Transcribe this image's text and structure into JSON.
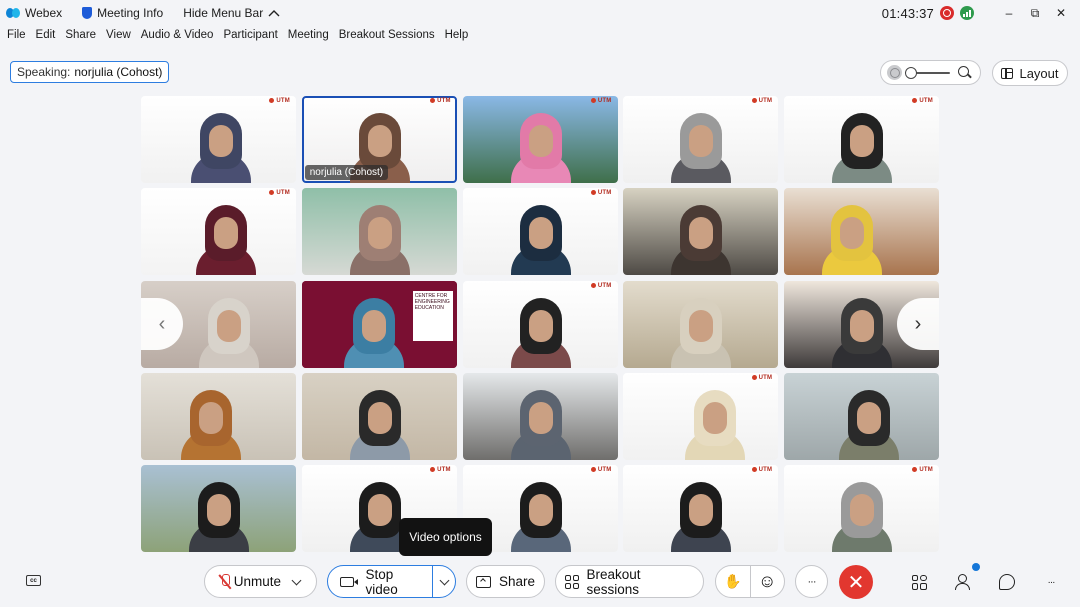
{
  "titlebar": {
    "app_name": "Webex",
    "meeting_info": "Meeting Info",
    "hide_menu_bar": "Hide Menu Bar",
    "time": "01:43:37",
    "minimize": "–",
    "restore": "⧉",
    "close": "✕"
  },
  "menu": [
    "File",
    "Edit",
    "Share",
    "View",
    "Audio & Video",
    "Participant",
    "Meeting",
    "Breakout Sessions",
    "Help"
  ],
  "speaking": {
    "label": "Speaking:",
    "name": "norjulia (Cohost)"
  },
  "layout_button": {
    "label": "Layout"
  },
  "zoom_level": 0,
  "tiles": [
    {
      "name": "",
      "brand": true,
      "bg": [
        "#ffffff",
        "#f1f1f1"
      ],
      "hair": "#3f4663",
      "shirt": "#4a4f72",
      "pos": 50
    },
    {
      "name": "norjulia (Cohost)",
      "brand": true,
      "active": true,
      "bg": [
        "#ffffff",
        "#efeeee"
      ],
      "hair": "#6a4a3a",
      "shirt": "#8a5f4b",
      "pos": 48
    },
    {
      "name": "",
      "brand": true,
      "bg": [
        "#8ab8e6",
        "#3f6f4a"
      ],
      "hair": "#e27aa8",
      "shirt": "#e888b6",
      "pos": 48
    },
    {
      "name": "",
      "brand": true,
      "bg": [
        "#ffffff",
        "#f0f0f0"
      ],
      "hair": "#9a9a9a",
      "shirt": "#5a5a60",
      "pos": 48
    },
    {
      "name": "",
      "brand": true,
      "bg": [
        "#ffffff",
        "#f0f0f0"
      ],
      "hair": "#222222",
      "shirt": "#7c8b84",
      "pos": 48
    },
    {
      "name": "",
      "brand": true,
      "bg": [
        "#ffffff",
        "#f3f3f3"
      ],
      "hair": "#5a1c2a",
      "shirt": "#6a1e2e",
      "pos": 55
    },
    {
      "name": "",
      "brand": false,
      "bg": [
        "#8fbfa8",
        "#d6d9d4"
      ],
      "hair": "#9e7f74",
      "shirt": "#8a7068",
      "pos": 48
    },
    {
      "name": "",
      "brand": true,
      "bg": [
        "#ffffff",
        "#f1f1f1"
      ],
      "hair": "#1c2d40",
      "shirt": "#223a52",
      "pos": 48
    },
    {
      "name": "",
      "brand": false,
      "bg": [
        "#d7d2c2",
        "#4e4a45"
      ],
      "hair": "#4b3b35",
      "shirt": "#3d3530",
      "pos": 48
    },
    {
      "name": "",
      "brand": false,
      "bg": [
        "#e9dfd3",
        "#a8744e"
      ],
      "hair": "#e3c33f",
      "shirt": "#ebc93e",
      "pos": 38
    },
    {
      "name": "",
      "brand": false,
      "bg": [
        "#d7cfc8",
        "#b8aba3"
      ],
      "hair": "#d8d3cb",
      "shirt": "#cfc7bf",
      "pos": 58
    },
    {
      "name": "",
      "brand": false,
      "banner": true,
      "bg": [
        "#7a0f32",
        "#7a0f32"
      ],
      "hair": "#3c7ea3",
      "shirt": "#4f8fb3",
      "pos": 42
    },
    {
      "name": "",
      "brand": true,
      "bg": [
        "#ffffff",
        "#f1f1f1"
      ],
      "hair": "#222222",
      "shirt": "#7b4a4a",
      "pos": 48
    },
    {
      "name": "",
      "brand": false,
      "bg": [
        "#e3dccd",
        "#b5a990"
      ],
      "hair": "#d8d0bf",
      "shirt": "#c9c2b2",
      "pos": 48
    },
    {
      "name": "",
      "brand": false,
      "bg": [
        "#efe7dd",
        "#3e3a3a"
      ],
      "hair": "#3a3a3a",
      "shirt": "#2f2f33",
      "pos": 48
    },
    {
      "name": "",
      "brand": false,
      "bg": [
        "#e4e0d8",
        "#c9c2b6"
      ],
      "hair": "#a8652e",
      "shirt": "#b57332",
      "pos": 40
    },
    {
      "name": "",
      "brand": false,
      "bg": [
        "#d8d1c4",
        "#c3b7a5"
      ],
      "hair": "#2a2a2a",
      "shirt": "#8d9aa8",
      "pos": 48
    },
    {
      "name": "",
      "brand": false,
      "bg": [
        "#e5e8ea",
        "#6f6e6c"
      ],
      "hair": "#5c6470",
      "shirt": "#5b6470",
      "pos": 48
    },
    {
      "name": "",
      "brand": true,
      "bg": [
        "#ffffff",
        "#f1f1f1"
      ],
      "hair": "#e7dcc1",
      "shirt": "#e3d7b6",
      "pos": 62
    },
    {
      "name": "",
      "brand": false,
      "bg": [
        "#c8d2d5",
        "#9ea7a9"
      ],
      "hair": "#2a2a2a",
      "shirt": "#7b7e6a",
      "pos": 55
    },
    {
      "name": "",
      "brand": false,
      "bg": [
        "#a9c0d3",
        "#8da278"
      ],
      "hair": "#1c1c1c",
      "shirt": "#3b3e45",
      "pos": 48
    },
    {
      "name": "",
      "brand": true,
      "bg": [
        "#ffffff",
        "#f0f0f0"
      ],
      "hair": "#1c1c1c",
      "shirt": "#3f4a5a",
      "pos": 48
    },
    {
      "name": "",
      "brand": true,
      "bg": [
        "#ffffff",
        "#f0f0f0"
      ],
      "hair": "#1c1c1c",
      "shirt": "#59677a",
      "pos": 48
    },
    {
      "name": "",
      "brand": true,
      "bg": [
        "#ffffff",
        "#f0f0f0"
      ],
      "hair": "#1c1c1c",
      "shirt": "#3e4450",
      "pos": 48
    },
    {
      "name": "",
      "brand": true,
      "bg": [
        "#ffffff",
        "#f0f0f0"
      ],
      "hair": "#9a9a9a",
      "shirt": "#6e7a6c",
      "pos": 48
    }
  ],
  "banner_text": "CENTRE FOR ENGINEERING EDUCATION",
  "brand_text": "UTM",
  "nav": {
    "prev": "‹",
    "next": "›"
  },
  "tooltip": "Video options",
  "toolbar": {
    "unmute": "Unmute",
    "stop_video": "Stop video",
    "share": "Share",
    "breakout": "Breakout sessions",
    "raise_hand": "✋",
    "reactions": "☺",
    "more": "···",
    "end": "✕",
    "overflow": "···",
    "cc": "cc"
  },
  "colors": {
    "accent": "#2d7de0",
    "end_call": "#e2372f",
    "mute_red": "#d93a35"
  }
}
